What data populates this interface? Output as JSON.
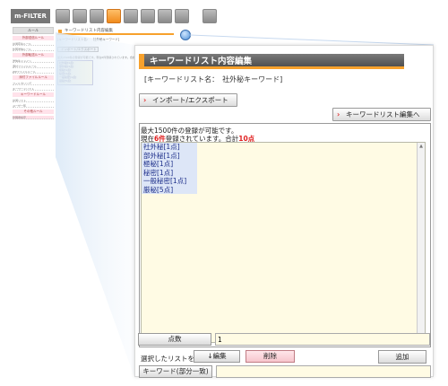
{
  "app": {
    "logo": "m-FILTER",
    "toolbar_icons": [
      "mail-icon",
      "archive-icon",
      "grid-icon",
      "keyword-icon",
      "report-icon",
      "search-icon",
      "barcode-icon",
      "user-icon",
      "settings-icon"
    ]
  },
  "mini": {
    "title": "キーワードリスト内容編集",
    "list_name": "[キーワードリスト名：　社外秘キーワード]",
    "import_button": "インポート/エクスポート",
    "note": "最大1500件の登録が可能です。現在6件登録されています。合計10点",
    "items": [
      "社外秘[1点]",
      "部外秘[1点]",
      "極秘[1点]",
      "秘密[1点]",
      "一般秘密[1点]",
      "厳秘[5点]"
    ],
    "sidebar": {
      "header": "ルール",
      "sections": [
        "外部送信ルール",
        "外部転送ルール",
        "添付ファイルルール",
        "キーワードルール",
        "その他ルール"
      ],
      "items": [
        "共通宛先ルール",
        "外部送信ルール",
        "送信先ドメイン",
        "添付ファイルルール",
        "ZIPファイルルール",
        "フィルタリング",
        "キーワードリスト",
        "共通リスト",
        "ユーザ一覧",
        "管理者設定"
      ]
    }
  },
  "panel": {
    "title": "キーワードリスト内容編集",
    "list_name": "[キーワードリスト名：　社外秘キーワード]",
    "import_button": "インポート/エクスポート",
    "edit_list_button": "キーワードリスト編集へ",
    "info": {
      "max_text": "最大1500件の登録が可能です。",
      "current_prefix": "現在",
      "current_count": "6件",
      "current_mid": "登録されています。合計",
      "total_points": "10点"
    },
    "items": [
      "社外秘[1点]",
      "部外秘[1点]",
      "極秘[1点]",
      "秘密[1点]",
      "一般秘密[1点]",
      "厳秘[5点]"
    ],
    "selected_label": "選択したリストを",
    "edit_button": "↓編集",
    "delete_button": "削除",
    "form": {
      "keyword_label": "キーワード(部分一致)",
      "keyword_value": "",
      "points_label": "点数",
      "points_value": "1",
      "add_button": "追加"
    }
  },
  "colors": {
    "accent": "#f7a12c",
    "title_bg": "#5f5f5f",
    "list_bg": "#fffbe4",
    "item_text": "#1d2f8a",
    "count_red": "#e02020",
    "delete_bg": "#f7c5cc"
  }
}
